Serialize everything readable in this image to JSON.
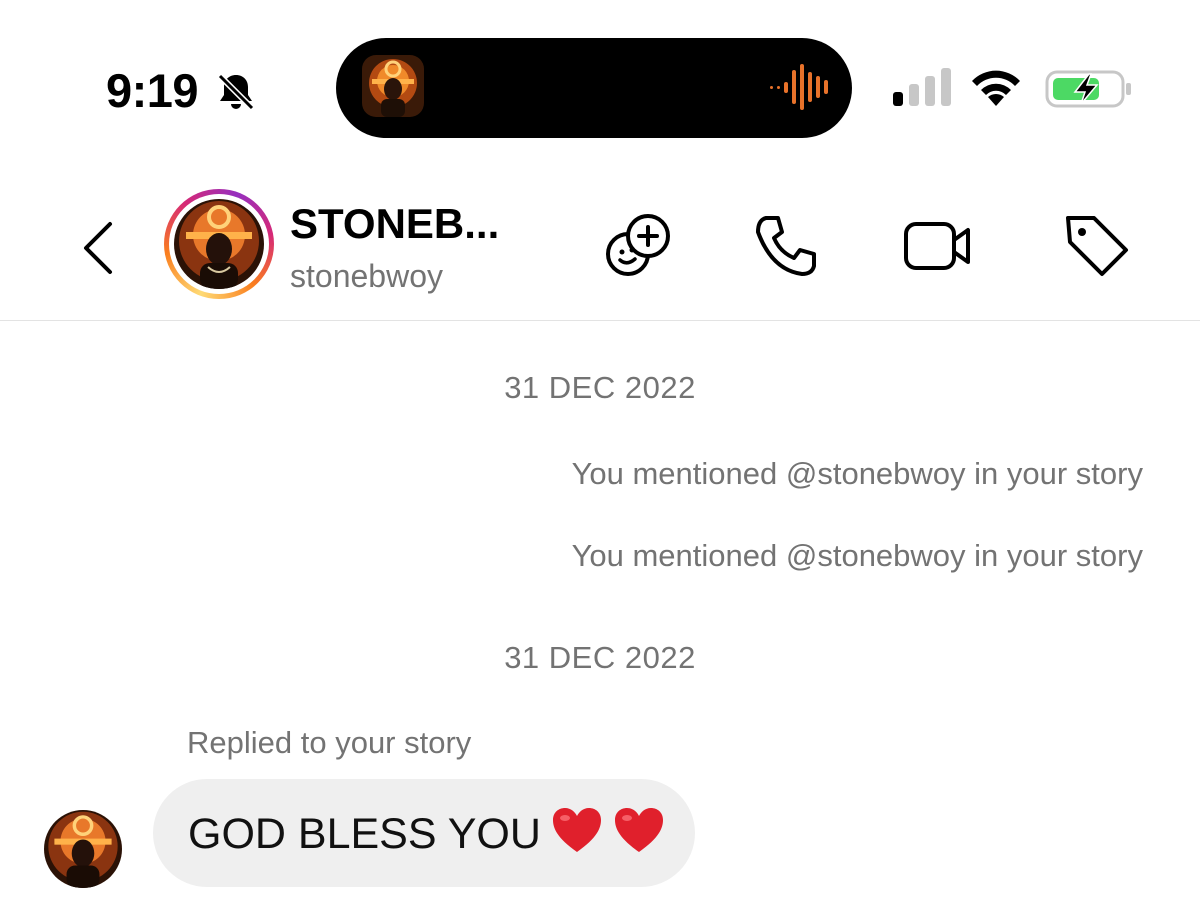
{
  "status_bar": {
    "time": "9:19",
    "icons": [
      "bell-slash-icon",
      "audio-wave-icon",
      "cellular-signal-icon",
      "wifi-icon",
      "battery-charging-icon"
    ],
    "accent_wave": "#e8722a",
    "battery_color": "#4cd964"
  },
  "header": {
    "display_name": "STONEB...",
    "username": "stonebwoy",
    "actions": [
      "effects-icon",
      "phone-icon",
      "video-icon",
      "tag-icon"
    ]
  },
  "chat": {
    "date_1": "31 DEC 2022",
    "mention_1": "You mentioned @stonebwoy in your story",
    "mention_2": "You mentioned @stonebwoy in your story",
    "date_2": "31 DEC 2022",
    "reply_label": "Replied to your story",
    "message": "GOD BLESS YOU"
  },
  "colors": {
    "secondary_text": "#737373",
    "bubble": "#efefef",
    "heart": "#e0202c"
  }
}
